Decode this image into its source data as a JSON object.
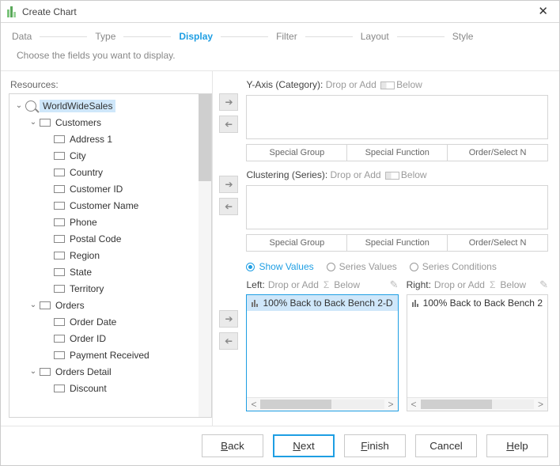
{
  "title": "Create Chart",
  "steps": [
    "Data",
    "Type",
    "Display",
    "Filter",
    "Layout",
    "Style"
  ],
  "active_step": "Display",
  "subtitle": "Choose the fields you want to display.",
  "resources_label": "Resources:",
  "tree": {
    "root": "WorldWideSales",
    "groups": [
      {
        "name": "Customers",
        "items": [
          "Address 1",
          "City",
          "Country",
          "Customer ID",
          "Customer Name",
          "Phone",
          "Postal Code",
          "Region",
          "State",
          "Territory"
        ]
      },
      {
        "name": "Orders",
        "items": [
          "Order Date",
          "Order ID",
          "Payment Received"
        ]
      },
      {
        "name": "Orders Detail",
        "items": [
          "Discount"
        ]
      }
    ]
  },
  "yaxis": {
    "label": "Y-Axis (Category):",
    "hint": "Drop or Add",
    "below": "Below"
  },
  "clustering": {
    "label": "Clustering (Series):",
    "hint": "Drop or Add",
    "below": "Below"
  },
  "buttons": {
    "special_group": "Special Group",
    "special_function": "Special Function",
    "order_select": "Order/Select N"
  },
  "radios": {
    "show_values": "Show Values",
    "series_values": "Series Values",
    "series_conditions": "Series Conditions"
  },
  "left_val": {
    "label": "Left:",
    "hint": "Drop or Add",
    "below": "Below",
    "item": "100% Back to Back Bench 2-D"
  },
  "right_val": {
    "label": "Right:",
    "hint": "Drop or Add",
    "below": "Below",
    "item": "100% Back to Back Bench 2"
  },
  "footer": {
    "back": "Back",
    "next": "Next",
    "finish": "Finish",
    "cancel": "Cancel",
    "help": "Help"
  }
}
